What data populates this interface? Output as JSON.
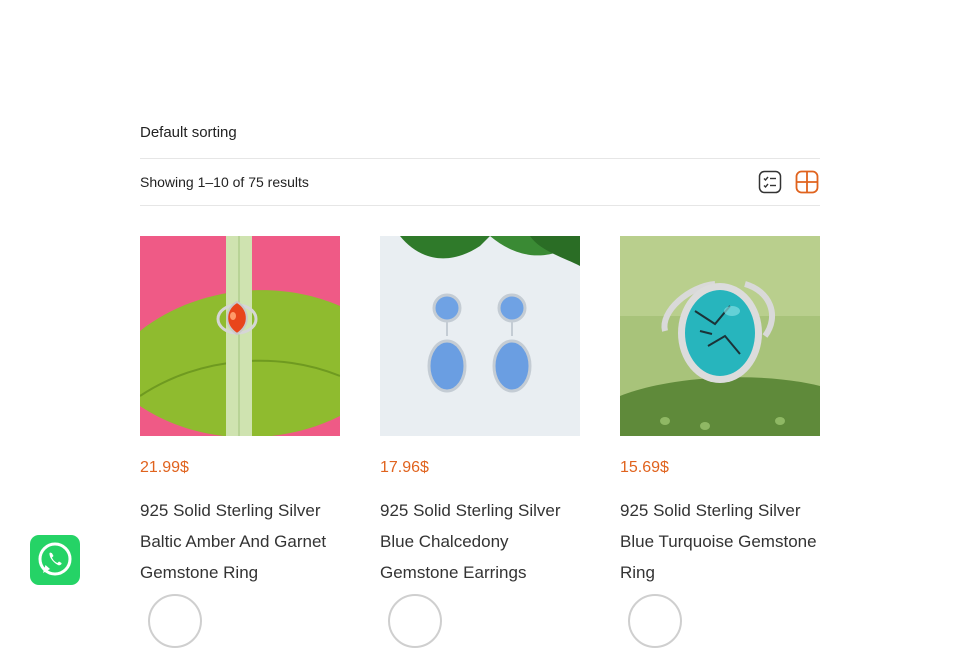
{
  "sorting": {
    "label": "Default sorting"
  },
  "toolbar": {
    "result_count": "Showing 1–10 of 75 results",
    "list_view_icon": "list-icon",
    "grid_view_icon": "grid-icon",
    "accent": "#e0631e"
  },
  "products": [
    {
      "price": "21.99",
      "currency": "$",
      "title": "925 Solid Sterling Silver Baltic Amber And Garnet Gemstone Ring"
    },
    {
      "price": "17.96",
      "currency": "$",
      "title": "925 Solid Sterling Silver Blue Chalcedony Gemstone Earrings"
    },
    {
      "price": "15.69",
      "currency": "$",
      "title": "925 Solid Sterling Silver Blue Turquoise Gemstone Ring"
    }
  ],
  "whatsapp": {
    "icon": "whatsapp-icon",
    "color": "#25d366"
  }
}
